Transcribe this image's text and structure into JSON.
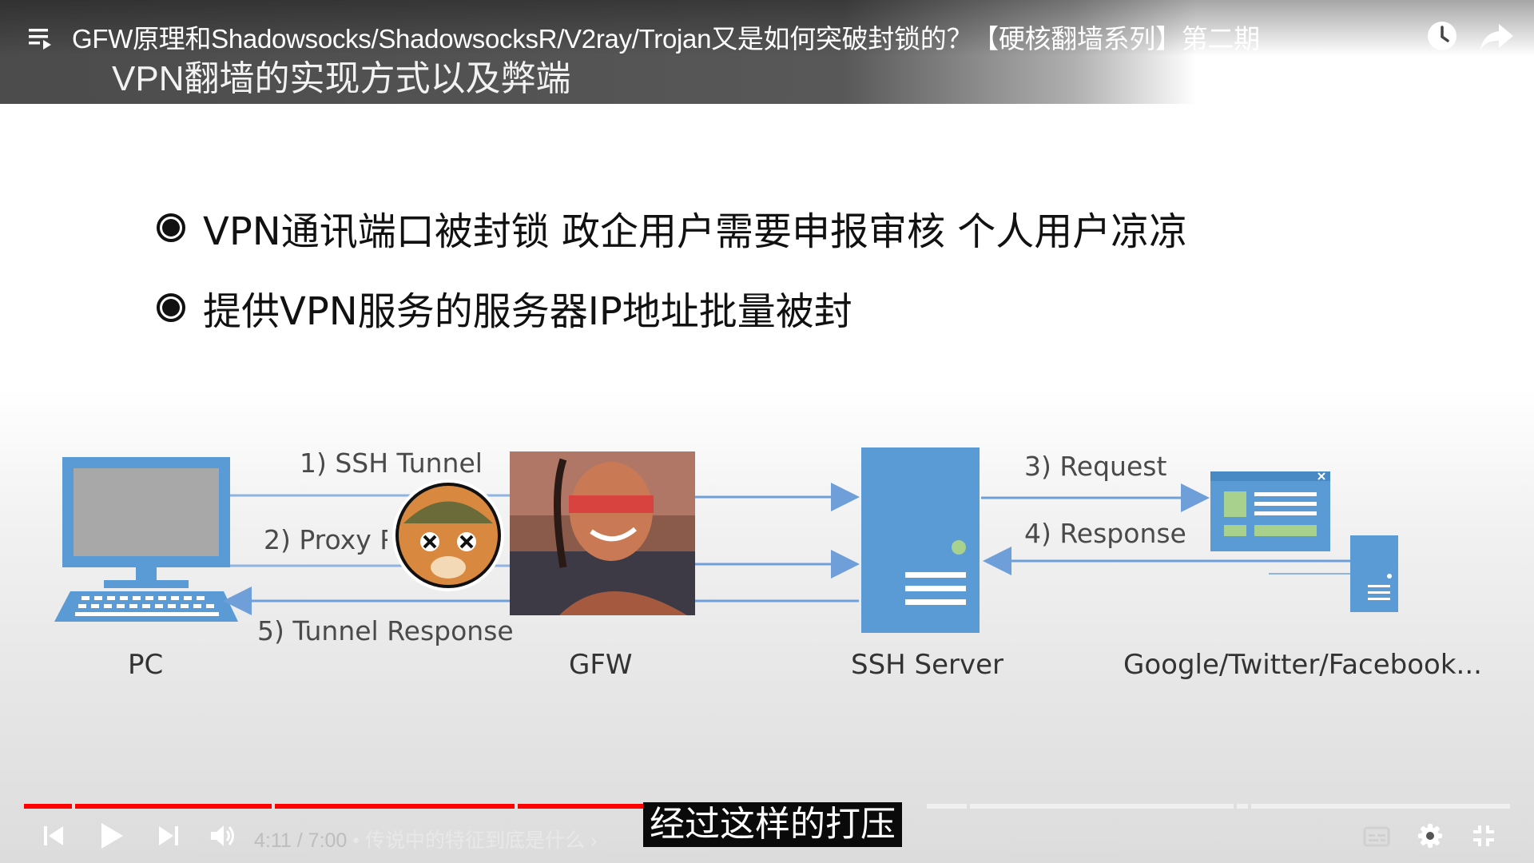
{
  "video": {
    "title": "GFW原理和Shadowsocks/ShadowsocksR/V2ray/Trojan又是如何突破封锁的？【硬核翻墙系列】第二期",
    "time_current": "4:11",
    "time_separator": "/",
    "time_total": "7:00",
    "chapter": "• 传说中的特征到底是什么 ›",
    "subtitle": "经过这样的打压",
    "progress_percent": 59.8,
    "accent_color": "#ff0000"
  },
  "slide": {
    "heading": "VPN翻墙的实现方式以及弊端",
    "bullets": [
      {
        "text": "VPN通讯端口被封锁 政企用户需要申报审核 个人用户凉凉"
      },
      {
        "text": "提供VPN服务的服务器IP地址批量被封"
      }
    ],
    "diagram": {
      "nodes": {
        "pc": "PC",
        "gfw": "GFW",
        "ssh_server": "SSH Server",
        "sites": "Google/Twitter/Facebook..."
      },
      "arrows": {
        "a1": "1) SSH Tunnel",
        "a2": "2) Proxy R",
        "a3": "3) Request",
        "a4": "4) Response",
        "a5": "5) Tunnel Response"
      },
      "colors": {
        "blue": "#5b9bd5",
        "green": "#a9d18e",
        "line": "#7fa7d6"
      }
    }
  },
  "icons": {
    "playlist": "playlist-icon",
    "watch_later": "clock-icon",
    "share": "share-icon",
    "previous": "skip-previous-icon",
    "play": "play-icon",
    "next": "skip-next-icon",
    "volume": "volume-icon",
    "captions": "subtitles-icon",
    "settings": "gear-icon",
    "fullscreen_exit": "exit-fullscreen-icon"
  }
}
